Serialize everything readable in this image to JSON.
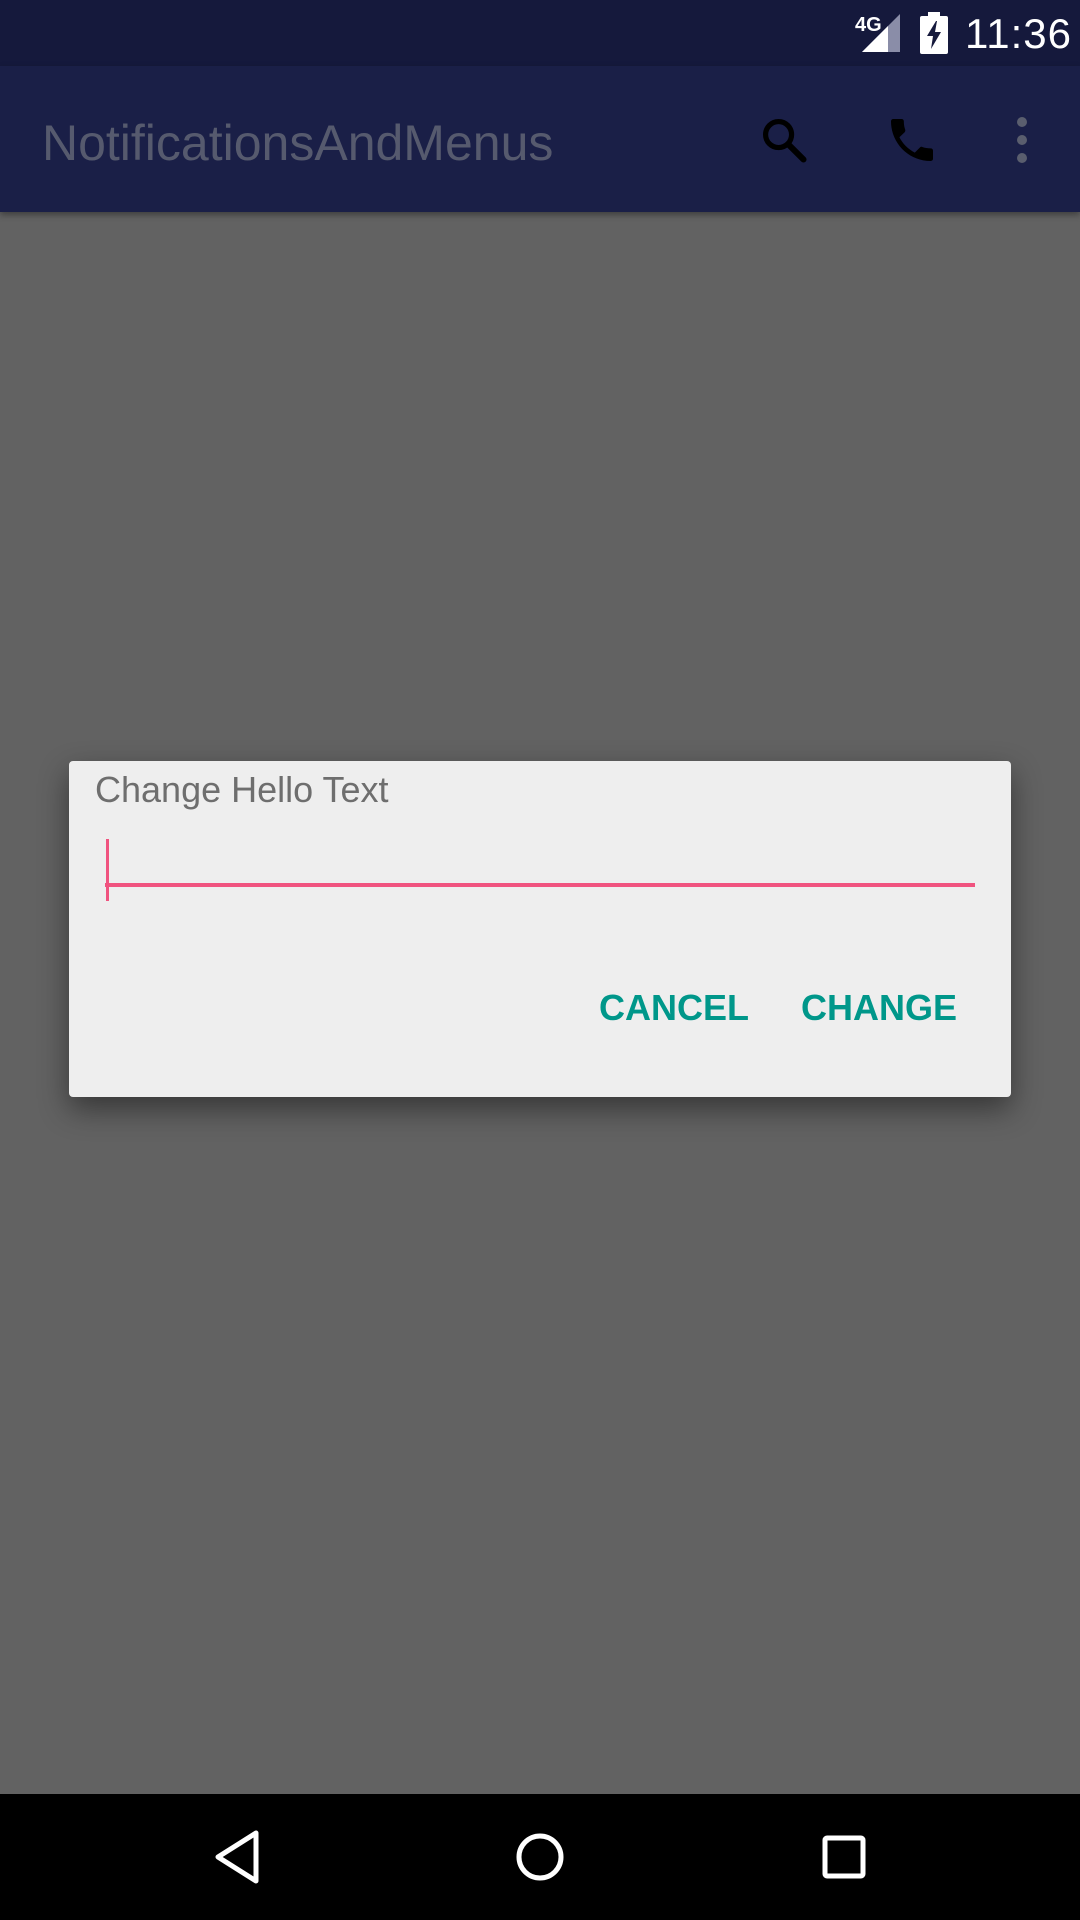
{
  "status_bar": {
    "network": "4G",
    "time": "11:36"
  },
  "app_bar": {
    "title": "NotificationsAndMenus",
    "actions": [
      {
        "icon": "search-icon"
      },
      {
        "icon": "phone-icon"
      },
      {
        "icon": "overflow-menu-icon"
      }
    ]
  },
  "dialog": {
    "title": "Change Hello Text",
    "input_value": "",
    "cancel_label": "CANCEL",
    "change_label": "CHANGE"
  },
  "nav_bar": {
    "buttons": [
      {
        "icon": "back-icon"
      },
      {
        "icon": "home-icon"
      },
      {
        "icon": "recents-icon"
      }
    ]
  },
  "colors": {
    "status_bar": "#15193c",
    "app_bar": "#1a1f47",
    "scrim": "#626262",
    "dialog_bg": "#eeeeee",
    "accent": "#f0537f",
    "button_text": "#00978a"
  }
}
